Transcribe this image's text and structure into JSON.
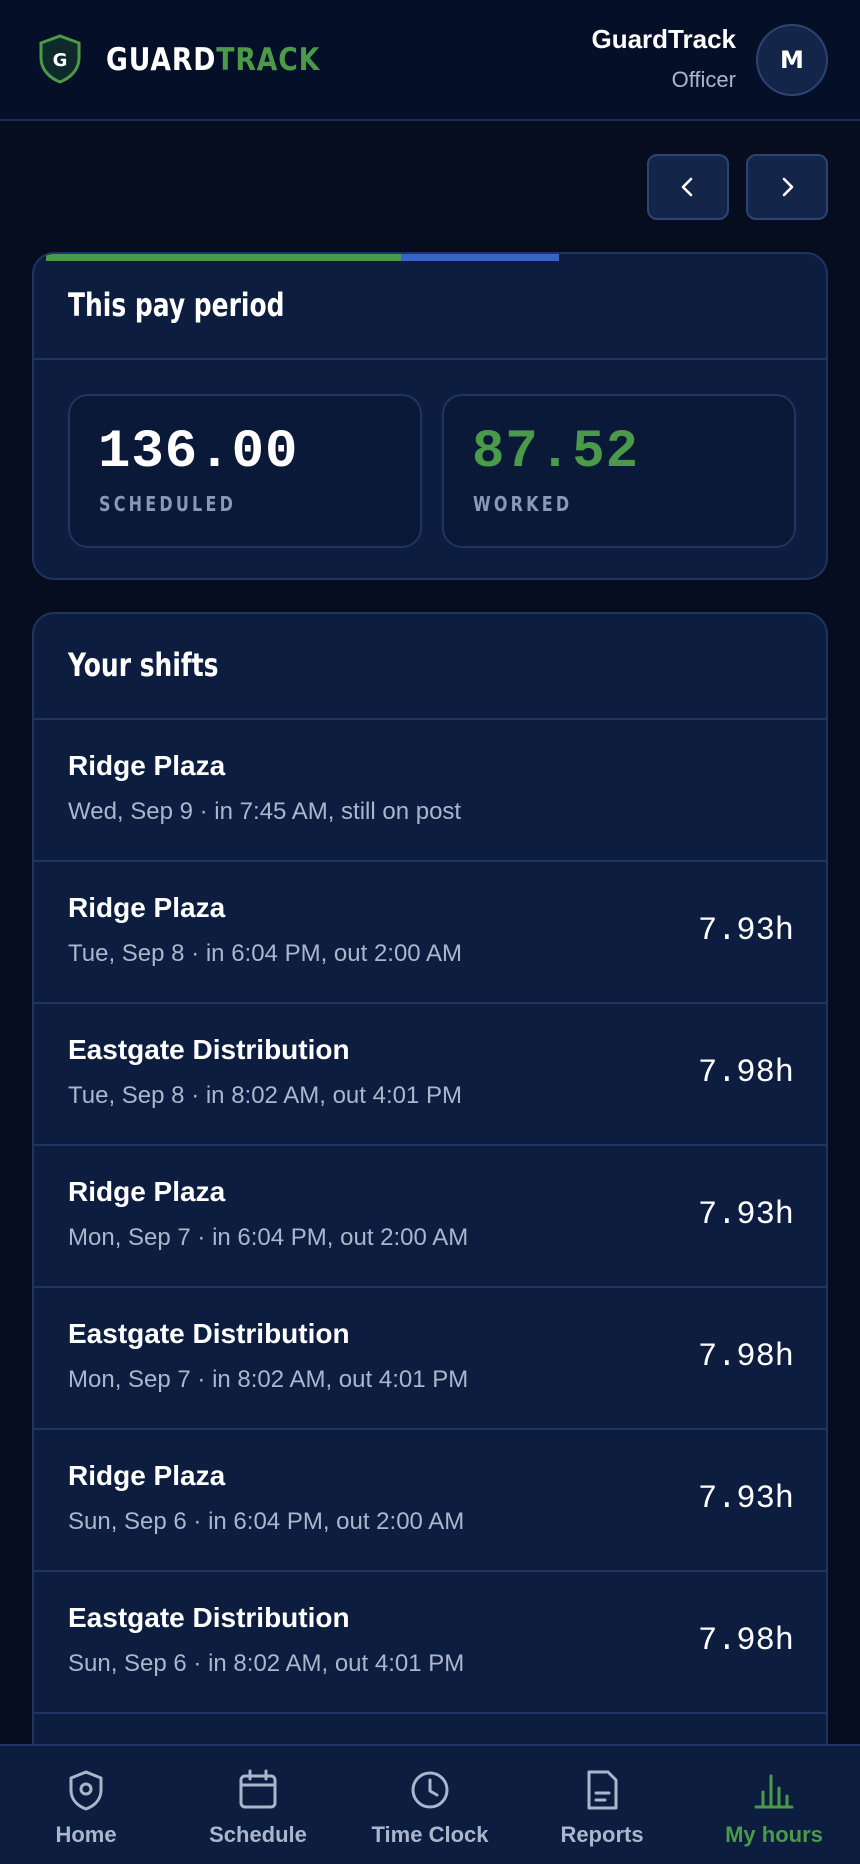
{
  "header": {
    "brand_part1": "GUARD",
    "brand_part2": "TRACK",
    "logo_letter": "G",
    "user_name": "GuardTrack",
    "user_role": "Officer",
    "avatar_initial": "M"
  },
  "pay_period": {
    "title": "This pay period",
    "scheduled_value": "136.00",
    "scheduled_label": "SCHEDULED",
    "worked_value": "87.52",
    "worked_label": "WORKED",
    "worked_fraction": 0.6435
  },
  "shifts": {
    "title": "Your shifts",
    "items": [
      {
        "site": "Ridge Plaza",
        "detail": "Wed, Sep 9 · in 7:45 AM, still on post",
        "hours": ""
      },
      {
        "site": "Ridge Plaza",
        "detail": "Tue, Sep 8 · in 6:04 PM, out 2:00 AM",
        "hours": "7.93h"
      },
      {
        "site": "Eastgate Distribution",
        "detail": "Tue, Sep 8 · in 8:02 AM, out 4:01 PM",
        "hours": "7.98h"
      },
      {
        "site": "Ridge Plaza",
        "detail": "Mon, Sep 7 · in 6:04 PM, out 2:00 AM",
        "hours": "7.93h"
      },
      {
        "site": "Eastgate Distribution",
        "detail": "Mon, Sep 7 · in 8:02 AM, out 4:01 PM",
        "hours": "7.98h"
      },
      {
        "site": "Ridge Plaza",
        "detail": "Sun, Sep 6 · in 6:04 PM, out 2:00 AM",
        "hours": "7.93h"
      },
      {
        "site": "Eastgate Distribution",
        "detail": "Sun, Sep 6 · in 8:02 AM, out 4:01 PM",
        "hours": "7.98h"
      }
    ]
  },
  "nav": {
    "items": [
      {
        "label": "Home",
        "icon": "shield-icon"
      },
      {
        "label": "Schedule",
        "icon": "calendar-icon"
      },
      {
        "label": "Time Clock",
        "icon": "clock-icon"
      },
      {
        "label": "Reports",
        "icon": "document-icon"
      },
      {
        "label": "My hours",
        "icon": "bar-chart-icon"
      }
    ],
    "active": "My hours"
  },
  "colors": {
    "background": "#050d1f",
    "card": "#0d1d3f",
    "accent_green": "#4a9a4a",
    "accent_blue": "#3a64c4",
    "muted_text": "#aab6cc"
  }
}
